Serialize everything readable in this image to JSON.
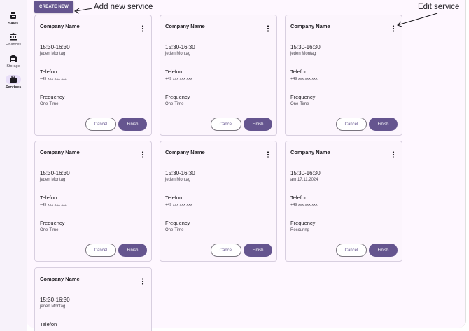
{
  "sidebar": {
    "items": [
      {
        "label": "Sales",
        "icon": "sales-icon"
      },
      {
        "label": "Finances",
        "icon": "bank-icon"
      },
      {
        "label": "Storage",
        "icon": "warehouse-icon"
      },
      {
        "label": "Services",
        "icon": "toolbox-icon",
        "active": true
      }
    ]
  },
  "toolbar": {
    "create_label": "CREATE NEW"
  },
  "annotations": {
    "add_new": "Add new service",
    "edit": "Edit service"
  },
  "colors": {
    "accent": "#65558f",
    "surface": "#fef7ff",
    "card": "#fcf5fd",
    "nav_active": "#e8def8"
  },
  "cards": [
    {
      "company": "Company Name",
      "time": "15:30-16:30",
      "day": "jeden Montag",
      "tel_label": "Telefon",
      "tel": "+49 xxx xxx xxx",
      "freq_label": "Frequency",
      "freq": "One-Time",
      "cancel": "Cancel",
      "finish": "Finish"
    },
    {
      "company": "Company Name",
      "time": "15:30-16:30",
      "day": "jeden Montag",
      "tel_label": "Telefon",
      "tel": "+49 xxx xxx xxx",
      "freq_label": "Frequency",
      "freq": "One-Time",
      "cancel": "Cancel",
      "finish": "Finish"
    },
    {
      "company": "Company Name",
      "time": "15:30-16:30",
      "day": "jeden Montag",
      "tel_label": "Telefon",
      "tel": "+49 xxx xxx xxx",
      "freq_label": "Frequency",
      "freq": "One-Time",
      "cancel": "Cancel",
      "finish": "Finish"
    },
    {
      "company": "Company Name",
      "time": "15:30-16:30",
      "day": "jeden Montag",
      "tel_label": "Telefon",
      "tel": "+49 xxx xxx xxx",
      "freq_label": "Frequency",
      "freq": "One-Time",
      "cancel": "Cancel",
      "finish": "Finish"
    },
    {
      "company": "Company Name",
      "time": "15:30-16:30",
      "day": "jeden Montag",
      "tel_label": "Telefon",
      "tel": "+49 xxx xxx xxx",
      "freq_label": "Frequency",
      "freq": "One-Time",
      "cancel": "Cancel",
      "finish": "Finish"
    },
    {
      "company": "Company Name",
      "time": "15:30-16:30",
      "day": "am 17.11.2024",
      "tel_label": "Telefon",
      "tel": "+49 xxx xxx xxx",
      "freq_label": "Frequency",
      "freq": "Reccuring",
      "cancel": "Cancel",
      "finish": "Finish"
    },
    {
      "company": "Company Name",
      "time": "15:30-16:30",
      "day": "jeden Montag",
      "tel_label": "Telefon"
    }
  ]
}
